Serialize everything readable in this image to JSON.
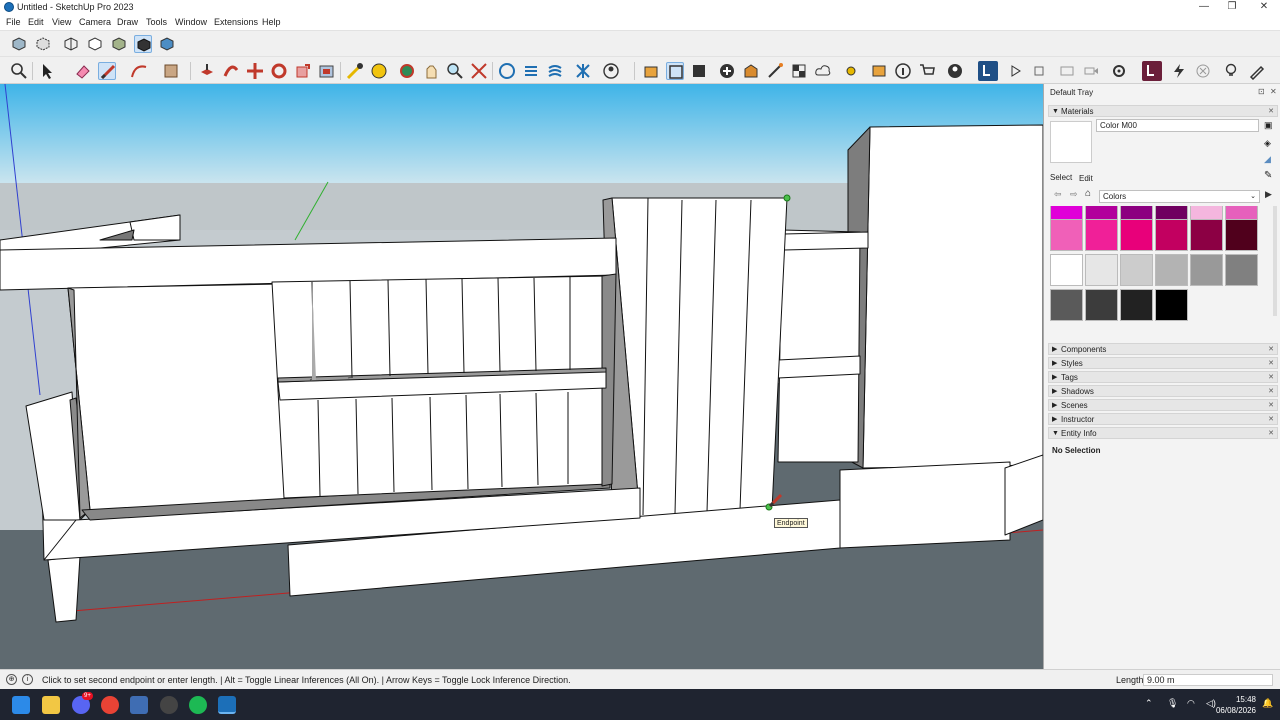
{
  "window": {
    "title": "Untitled - SketchUp Pro 2023",
    "minimize_glyph": "—",
    "maximize_glyph": "❐",
    "close_glyph": "✕"
  },
  "menu": [
    "File",
    "Edit",
    "View",
    "Camera",
    "Draw",
    "Tools",
    "Window",
    "Extensions",
    "Help"
  ],
  "viewport": {
    "tooltip": "Endpoint",
    "sky_top": "#40b6e8",
    "sky_bottom": "#c8e4ef",
    "ground": "#5f6a70"
  },
  "tray": {
    "title": "Default Tray",
    "materials_header": "Materials",
    "material_name": "Color M00",
    "tab_select": "Select",
    "tab_edit": "Edit",
    "collection": "Colors",
    "swatches": [
      [
        "#e000d8",
        "#b2009c",
        "#8c0080",
        "#700060",
        "#f4b6de",
        "#e660bc"
      ],
      [
        "#f060b8",
        "#f02098",
        "#e8007a",
        "#c20060",
        "#8c0044",
        "#50001c"
      ],
      [
        "#ffffff",
        "#e6e6e6",
        "#cccccc",
        "#b3b3b3",
        "#999999",
        "#808080"
      ],
      [
        "#5a5a5a",
        "#3c3c3c",
        "#222222",
        "#000000"
      ]
    ],
    "panels": [
      "Components",
      "Styles",
      "Tags",
      "Shadows",
      "Scenes",
      "Instructor",
      "Entity Info"
    ],
    "entity_info_text": "No Selection"
  },
  "status": {
    "hint": "Click to set second endpoint or enter length. | Alt = Toggle Linear Inferences (All On). | Arrow Keys = Toggle Lock Inference Direction.",
    "length_label": "Length",
    "length_value": "9.00 m"
  },
  "taskbar": {
    "time": "15:48",
    "date": "06/08/2026",
    "discord_badge": "9+"
  }
}
